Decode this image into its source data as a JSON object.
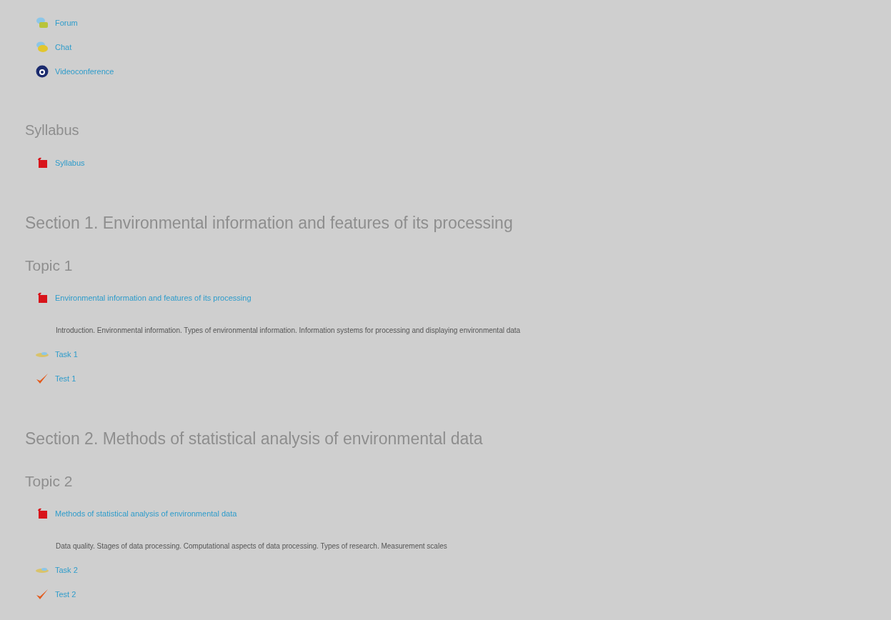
{
  "entries": [
    {
      "kind": "forum",
      "label": "Forum"
    },
    {
      "kind": "chat",
      "label": "Chat"
    },
    {
      "kind": "video",
      "label": "Videoconference"
    },
    {
      "kind": "block",
      "title": "Syllabus"
    },
    {
      "kind": "file",
      "label": "Syllabus"
    },
    {
      "kind": "section",
      "title": "Section 1. Environmental information and features of its processing"
    },
    {
      "kind": "topic",
      "title": "Topic 1"
    },
    {
      "kind": "file",
      "label": "Environmental information and features of its processing"
    },
    {
      "kind": "description",
      "text": "Introduction. Environmental information. Types of environmental information. Information systems for processing and displaying environmental data"
    },
    {
      "kind": "assignment",
      "label": "Task 1"
    },
    {
      "kind": "quiz",
      "label": "Test 1"
    },
    {
      "kind": "section",
      "title": "Section 2. Methods of statistical analysis of environmental data"
    },
    {
      "kind": "topic",
      "title": "Topic 2"
    },
    {
      "kind": "file",
      "label": "Methods of statistical analysis of environmental data"
    },
    {
      "kind": "description",
      "text": "Data quality. Stages of data processing. Computational aspects of data processing. Types of research. Measurement scales"
    },
    {
      "kind": "assignment",
      "label": "Task 2"
    },
    {
      "kind": "quiz",
      "label": "Test 2"
    }
  ]
}
